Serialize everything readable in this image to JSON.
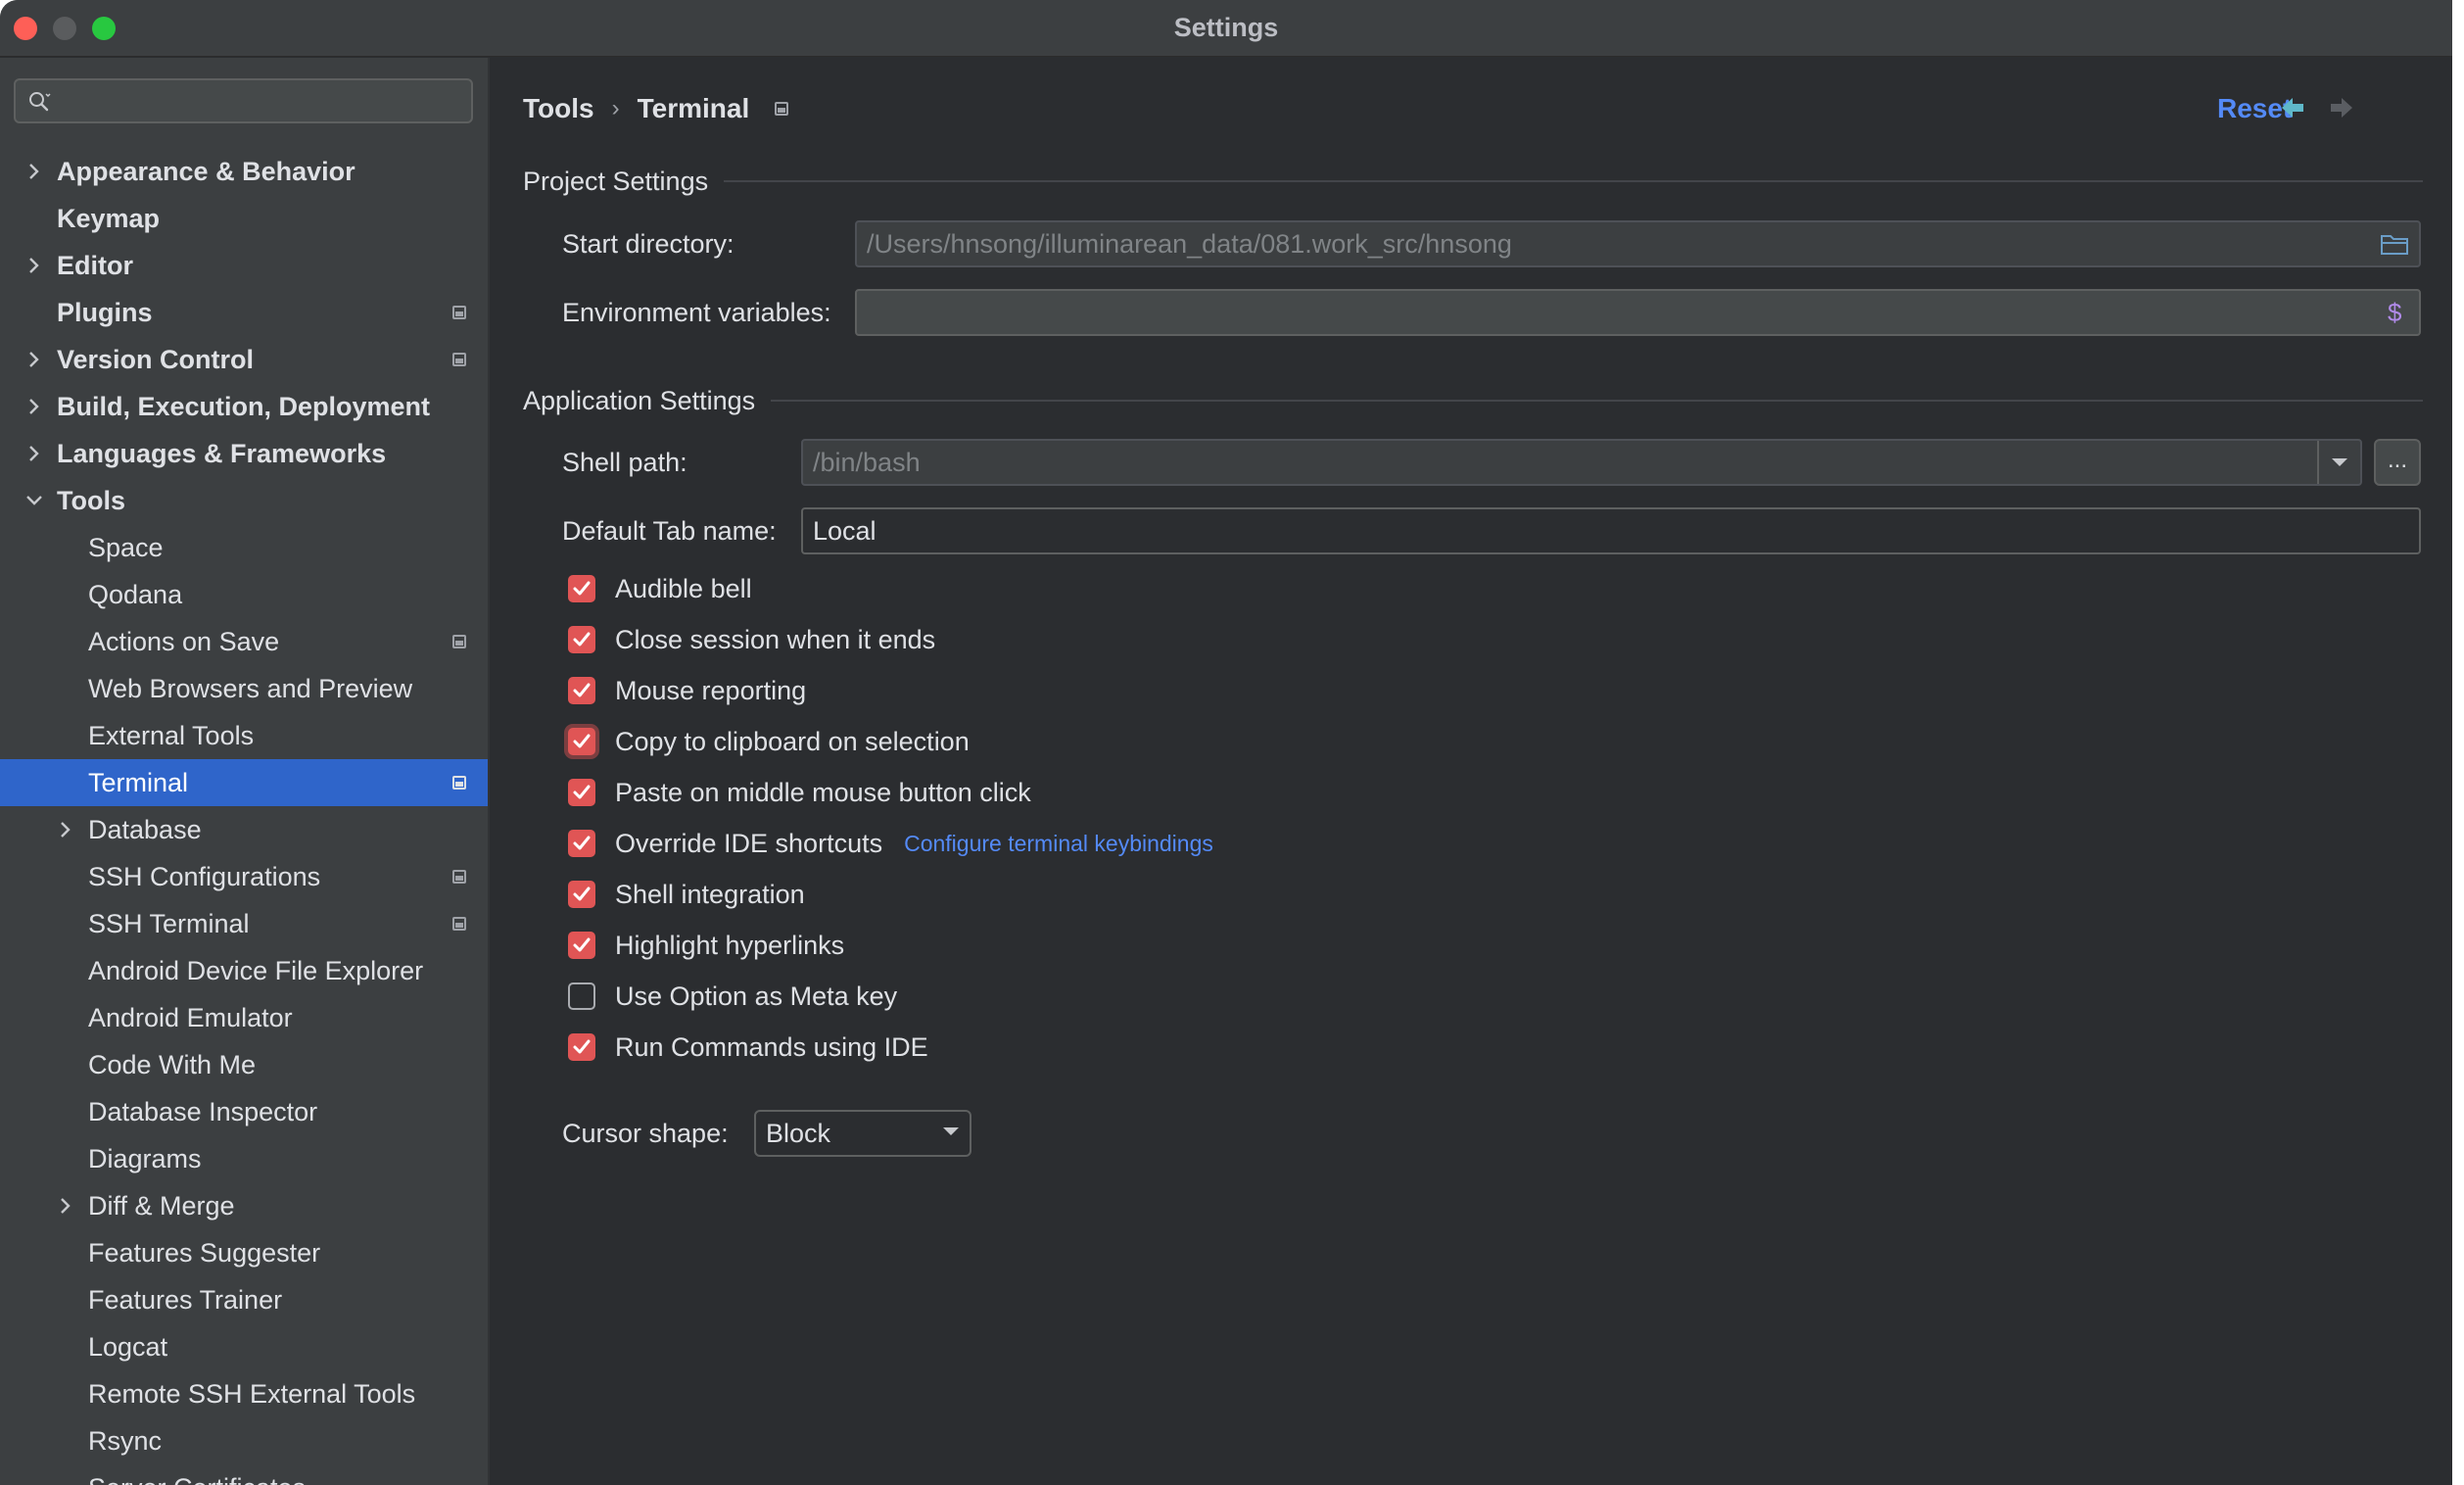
{
  "window": {
    "title": "Settings"
  },
  "search": {
    "placeholder": ""
  },
  "sidebar": {
    "items": [
      {
        "label": "Appearance & Behavior",
        "level": 0,
        "bold": true,
        "chevron": "right",
        "badge": false,
        "selected": false
      },
      {
        "label": "Keymap",
        "level": 0,
        "bold": true,
        "chevron": "none",
        "badge": false,
        "selected": false
      },
      {
        "label": "Editor",
        "level": 0,
        "bold": true,
        "chevron": "right",
        "badge": false,
        "selected": false
      },
      {
        "label": "Plugins",
        "level": 0,
        "bold": true,
        "chevron": "none",
        "badge": true,
        "selected": false
      },
      {
        "label": "Version Control",
        "level": 0,
        "bold": true,
        "chevron": "right",
        "badge": true,
        "selected": false
      },
      {
        "label": "Build, Execution, Deployment",
        "level": 0,
        "bold": true,
        "chevron": "right",
        "badge": false,
        "selected": false
      },
      {
        "label": "Languages & Frameworks",
        "level": 0,
        "bold": true,
        "chevron": "right",
        "badge": false,
        "selected": false
      },
      {
        "label": "Tools",
        "level": 0,
        "bold": true,
        "chevron": "down",
        "badge": false,
        "selected": false
      },
      {
        "label": "Space",
        "level": 1,
        "bold": false,
        "chevron": "none",
        "badge": false,
        "selected": false
      },
      {
        "label": "Qodana",
        "level": 1,
        "bold": false,
        "chevron": "none",
        "badge": false,
        "selected": false
      },
      {
        "label": "Actions on Save",
        "level": 1,
        "bold": false,
        "chevron": "none",
        "badge": true,
        "selected": false
      },
      {
        "label": "Web Browsers and Preview",
        "level": 1,
        "bold": false,
        "chevron": "none",
        "badge": false,
        "selected": false
      },
      {
        "label": "External Tools",
        "level": 1,
        "bold": false,
        "chevron": "none",
        "badge": false,
        "selected": false
      },
      {
        "label": "Terminal",
        "level": 1,
        "bold": false,
        "chevron": "none",
        "badge": true,
        "selected": true
      },
      {
        "label": "Database",
        "level": 1,
        "bold": false,
        "chevron": "right",
        "badge": false,
        "selected": false
      },
      {
        "label": "SSH Configurations",
        "level": 1,
        "bold": false,
        "chevron": "none",
        "badge": true,
        "selected": false
      },
      {
        "label": "SSH Terminal",
        "level": 1,
        "bold": false,
        "chevron": "none",
        "badge": true,
        "selected": false
      },
      {
        "label": "Android Device File Explorer",
        "level": 1,
        "bold": false,
        "chevron": "none",
        "badge": false,
        "selected": false
      },
      {
        "label": "Android Emulator",
        "level": 1,
        "bold": false,
        "chevron": "none",
        "badge": false,
        "selected": false
      },
      {
        "label": "Code With Me",
        "level": 1,
        "bold": false,
        "chevron": "none",
        "badge": false,
        "selected": false
      },
      {
        "label": "Database Inspector",
        "level": 1,
        "bold": false,
        "chevron": "none",
        "badge": false,
        "selected": false
      },
      {
        "label": "Diagrams",
        "level": 1,
        "bold": false,
        "chevron": "none",
        "badge": false,
        "selected": false
      },
      {
        "label": "Diff & Merge",
        "level": 1,
        "bold": false,
        "chevron": "right",
        "badge": false,
        "selected": false
      },
      {
        "label": "Features Suggester",
        "level": 1,
        "bold": false,
        "chevron": "none",
        "badge": false,
        "selected": false
      },
      {
        "label": "Features Trainer",
        "level": 1,
        "bold": false,
        "chevron": "none",
        "badge": false,
        "selected": false
      },
      {
        "label": "Logcat",
        "level": 1,
        "bold": false,
        "chevron": "none",
        "badge": false,
        "selected": false
      },
      {
        "label": "Remote SSH External Tools",
        "level": 1,
        "bold": false,
        "chevron": "none",
        "badge": false,
        "selected": false
      },
      {
        "label": "Rsync",
        "level": 1,
        "bold": false,
        "chevron": "none",
        "badge": false,
        "selected": false
      },
      {
        "label": "Server Certificates",
        "level": 1,
        "bold": false,
        "chevron": "none",
        "badge": false,
        "selected": false
      }
    ]
  },
  "header": {
    "breadcrumb_parent": "Tools",
    "breadcrumb_separator": "›",
    "breadcrumb_current": "Terminal",
    "reset_label": "Reset"
  },
  "project_settings": {
    "title": "Project Settings",
    "start_directory_label": "Start directory:",
    "start_directory_value": "/Users/hnsong/illuminarean_data/081.work_src/hnsong",
    "env_vars_label": "Environment variables:",
    "env_vars_value": ""
  },
  "application_settings": {
    "title": "Application Settings",
    "shell_path_label": "Shell path:",
    "shell_path_value": "/bin/bash",
    "browse_label": "...",
    "default_tab_label": "Default Tab name:",
    "default_tab_value": "Local",
    "checkboxes": [
      {
        "label": "Audible bell",
        "checked": true,
        "focused": false
      },
      {
        "label": "Close session when it ends",
        "checked": true,
        "focused": false
      },
      {
        "label": "Mouse reporting",
        "checked": true,
        "focused": false
      },
      {
        "label": "Copy to clipboard on selection",
        "checked": true,
        "focused": true
      },
      {
        "label": "Paste on middle mouse button click",
        "checked": true,
        "focused": false
      },
      {
        "label": "Override IDE shortcuts",
        "checked": true,
        "focused": false,
        "link": "Configure terminal keybindings"
      },
      {
        "label": "Shell integration",
        "checked": true,
        "focused": false
      },
      {
        "label": "Highlight hyperlinks",
        "checked": true,
        "focused": false
      },
      {
        "label": "Use Option as Meta key",
        "checked": false,
        "focused": false
      },
      {
        "label": "Run Commands using IDE",
        "checked": true,
        "focused": false
      }
    ],
    "cursor_shape_label": "Cursor shape:",
    "cursor_shape_value": "Block"
  },
  "colors": {
    "accent": "#2f65ca",
    "link": "#548af7",
    "checkbox": "#e05555"
  }
}
